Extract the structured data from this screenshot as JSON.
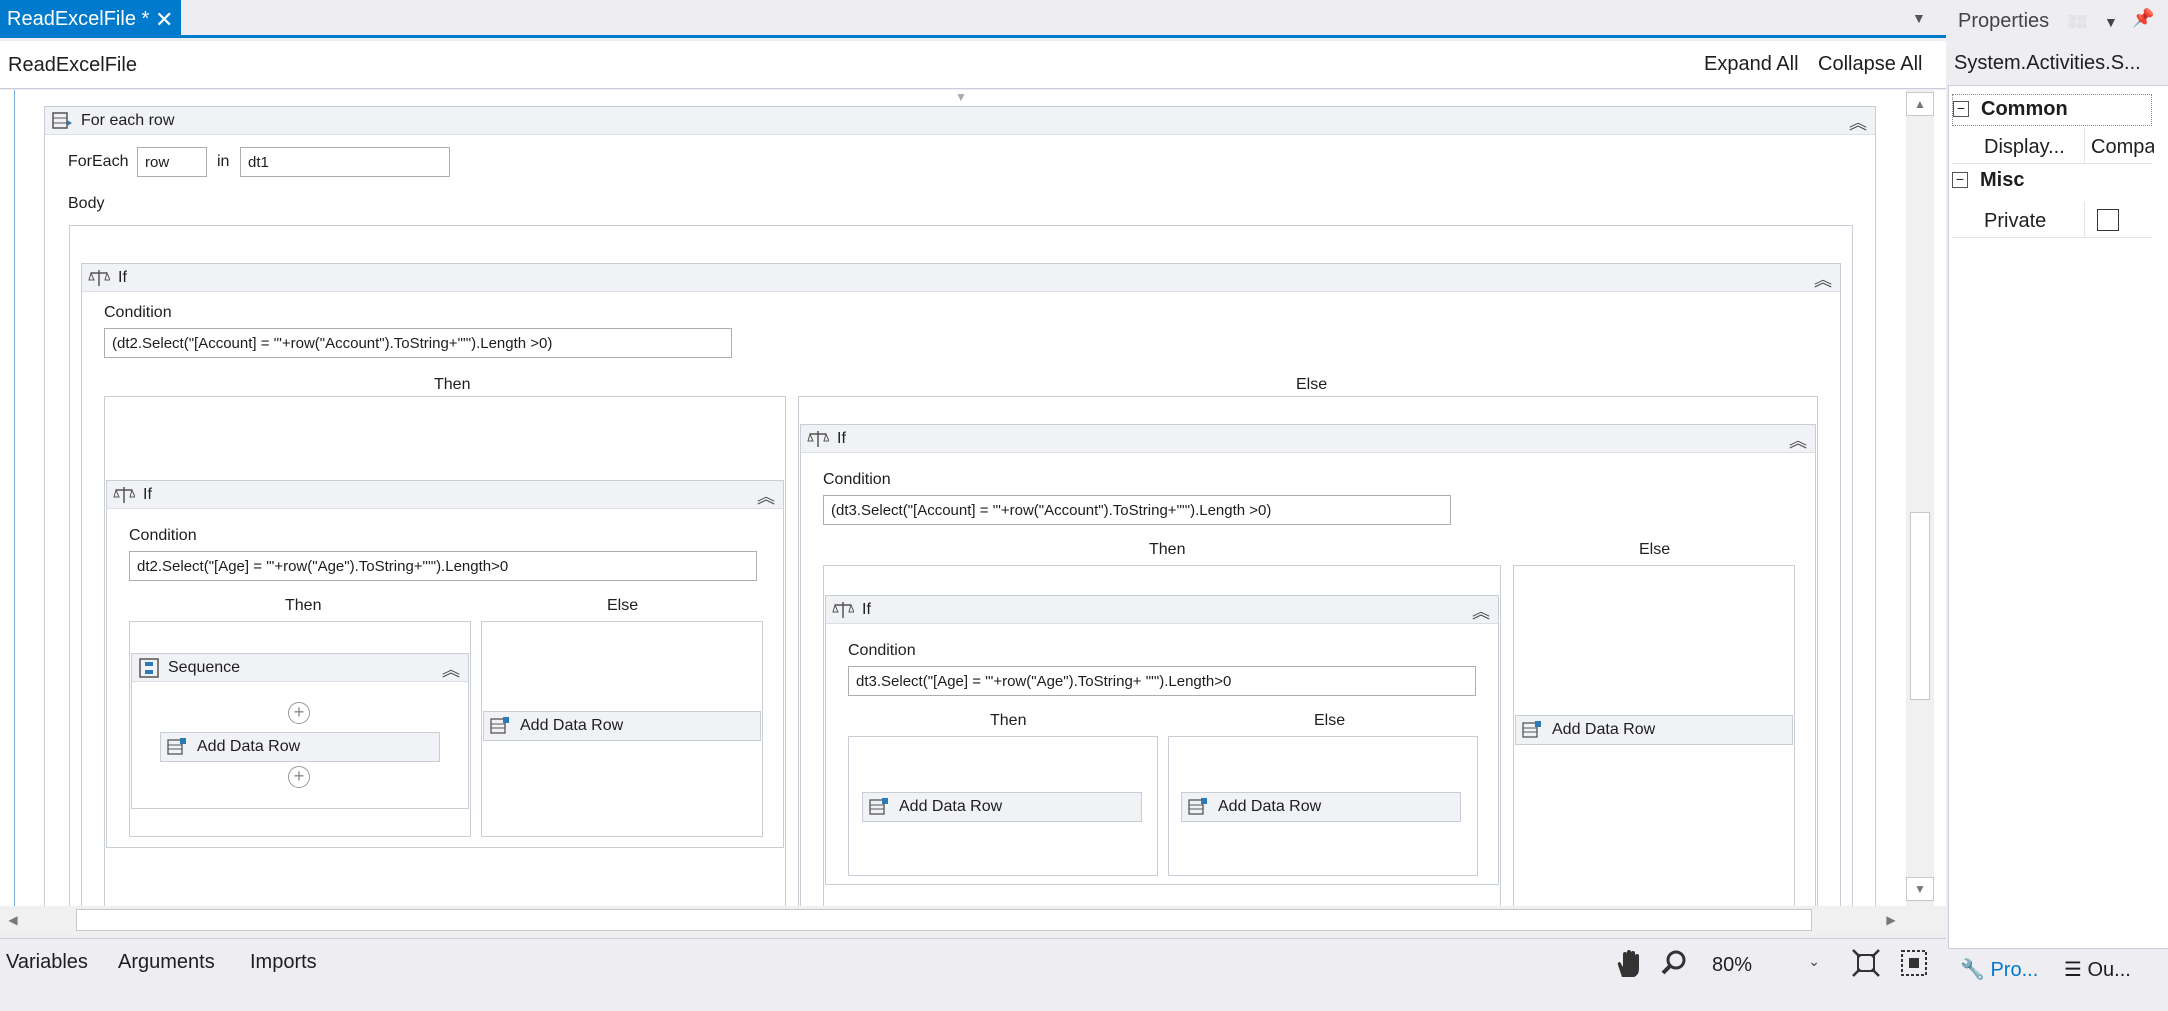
{
  "document_tab": {
    "title": "ReadExcelFile *",
    "close": "✕"
  },
  "breadcrumb": {
    "title": "ReadExcelFile",
    "expand_all": "Expand All",
    "collapse_all": "Collapse All"
  },
  "foreach": {
    "title": "For each row",
    "foreach_label": "ForEach",
    "item_value": "row",
    "in_label": "in",
    "collection_value": "dt1",
    "body_label": "Body"
  },
  "if_outer": {
    "title": "If",
    "condition_label": "Condition",
    "condition": "(dt2.Select(\"[Account] = '\"+row(\"Account\").ToString+\"'\").Length >0)",
    "then_label": "Then",
    "else_label": "Else"
  },
  "if_then": {
    "title": "If",
    "condition_label": "Condition",
    "condition": "dt2.Select(\"[Age] = '\"+row(\"Age\").ToString+\"'\").Length>0",
    "then_label": "Then",
    "else_label": "Else",
    "sequence_title": "Sequence",
    "add_data_row": "Add Data Row",
    "else_add_data_row": "Add Data Row"
  },
  "if_else": {
    "title": "If",
    "condition_label": "Condition",
    "condition": "(dt3.Select(\"[Account] = '\"+row(\"Account\").ToString+\"'\").Length >0)",
    "then_label": "Then",
    "else_label": "Else",
    "else_add_data_row": "Add Data Row"
  },
  "if_inner": {
    "title": "If",
    "condition_label": "Condition",
    "condition": "dt3.Select(\"[Age] = '\"+row(\"Age\").ToString+ \"'\").Length>0",
    "then_label": "Then",
    "else_label": "Else",
    "then_add_data_row": "Add Data Row",
    "else_add_data_row": "Add Data Row"
  },
  "bottom_tabs": {
    "variables": "Variables",
    "arguments": "Arguments",
    "imports": "Imports"
  },
  "zoom": {
    "value": "80%"
  },
  "properties": {
    "title": "Properties",
    "type": "System.Activities.S...",
    "common": "Common",
    "display_name_label": "Display...",
    "display_name_value": "Compa",
    "misc": "Misc",
    "private_label": "Private",
    "tab_properties": "Pro...",
    "tab_outline": "Ou..."
  },
  "colors": {
    "accent": "#007acc"
  },
  "icons": [
    "close-icon",
    "dropdown-icon",
    "collapse-chevron-icon",
    "foreach-icon",
    "if-icon",
    "sequence-icon",
    "add-data-row-icon",
    "hand-icon",
    "zoom-icon",
    "fit-screen-icon",
    "overview-icon",
    "pin-icon",
    "wrench-icon",
    "outline-icon"
  ]
}
